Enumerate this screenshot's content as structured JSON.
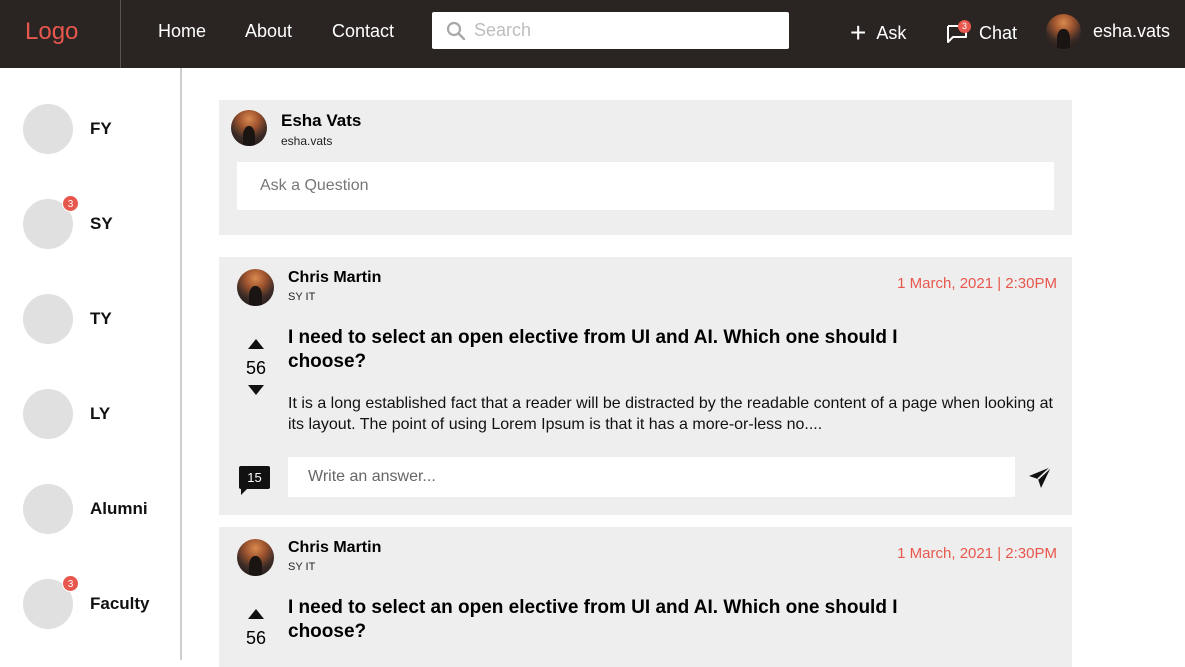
{
  "navbar": {
    "logo": "Logo",
    "links": [
      "Home",
      "About",
      "Contact"
    ],
    "search_placeholder": "Search",
    "ask_label": "Ask",
    "chat_label": "Chat",
    "chat_badge": "3",
    "username": "esha.vats"
  },
  "sidebar": {
    "items": [
      {
        "label": "FY",
        "badge": ""
      },
      {
        "label": "SY",
        "badge": "3"
      },
      {
        "label": "TY",
        "badge": ""
      },
      {
        "label": "LY",
        "badge": ""
      },
      {
        "label": "Alumni",
        "badge": ""
      },
      {
        "label": "Faculty",
        "badge": "3"
      }
    ]
  },
  "ask_card": {
    "name": "Esha Vats",
    "handle": "esha.vats",
    "placeholder": "Ask a Question"
  },
  "posts": [
    {
      "author": "Chris Martin",
      "class": "SY IT",
      "date": "1 March, 2021 | 2:30PM",
      "votes": "56",
      "title": "I need to select an open elective from UI and AI. Which one should I choose?",
      "body": "It is a long established fact that a reader will be distracted by the readable content of a page when looking at its layout. The point of using Lorem Ipsum is that it has a more-or-less no....",
      "comments": "15",
      "answer_placeholder": "Write an answer..."
    },
    {
      "author": "Chris Martin",
      "class": "SY IT",
      "date": "1 March, 2021 | 2:30PM",
      "votes": "56",
      "title": "I need to select an open elective from UI and AI. Which one should I choose?"
    }
  ],
  "colors": {
    "navbar_bg": "#2a2523",
    "accent": "#e8574d",
    "card_bg": "#eeeeee",
    "sidebar_circle": "#e0e0e0"
  }
}
